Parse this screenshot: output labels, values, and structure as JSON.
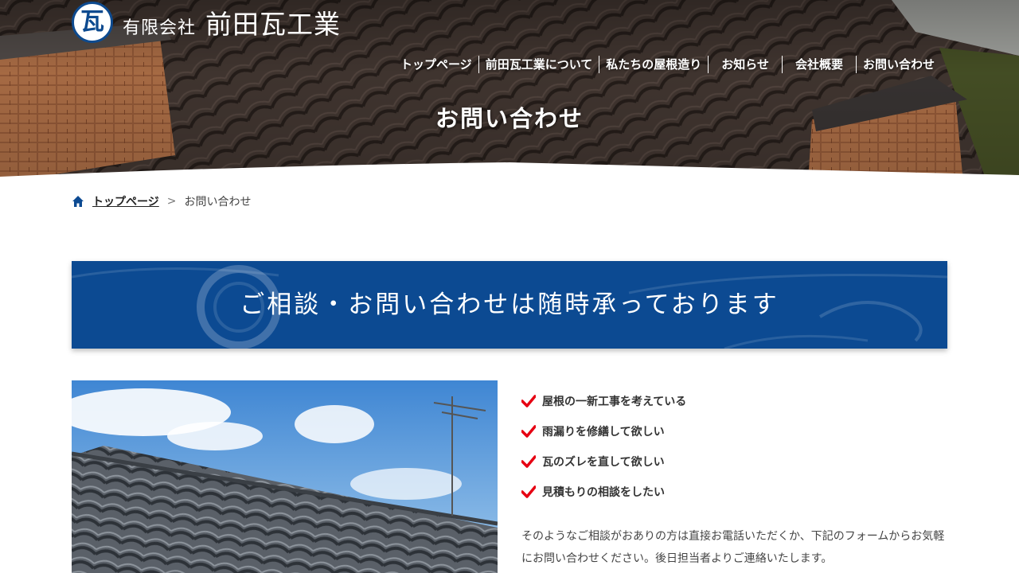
{
  "header": {
    "logo_mark": "瓦",
    "company_prefix": "有限会社",
    "company_name": "前田瓦工業",
    "nav": [
      "トップページ",
      "前田瓦工業について",
      "私たちの屋根造り",
      "お知らせ",
      "会社概要",
      "お問い合わせ"
    ]
  },
  "hero": {
    "title": "お問い合わせ"
  },
  "breadcrumb": {
    "home": "トップページ",
    "separator": ">",
    "current": "お問い合わせ"
  },
  "banner": {
    "text": "ご相談・お問い合わせは随時承っております"
  },
  "checklist": [
    "屋根の一新工事を考えている",
    "雨漏りを修繕して欲しい",
    "瓦のズレを直して欲しい",
    "見積もりの相談をしたい"
  ],
  "description": "そのようなご相談がおありの方は直接お電話いただくか、下記のフォームからお気軽にお問い合わせください。後日担当者よりご連絡いたします。",
  "colors": {
    "brand_blue": "#0c4a92",
    "check_red": "#e60012",
    "nav_text": "#ffffff"
  },
  "icons": {
    "home": "home-icon",
    "check": "check-icon"
  }
}
